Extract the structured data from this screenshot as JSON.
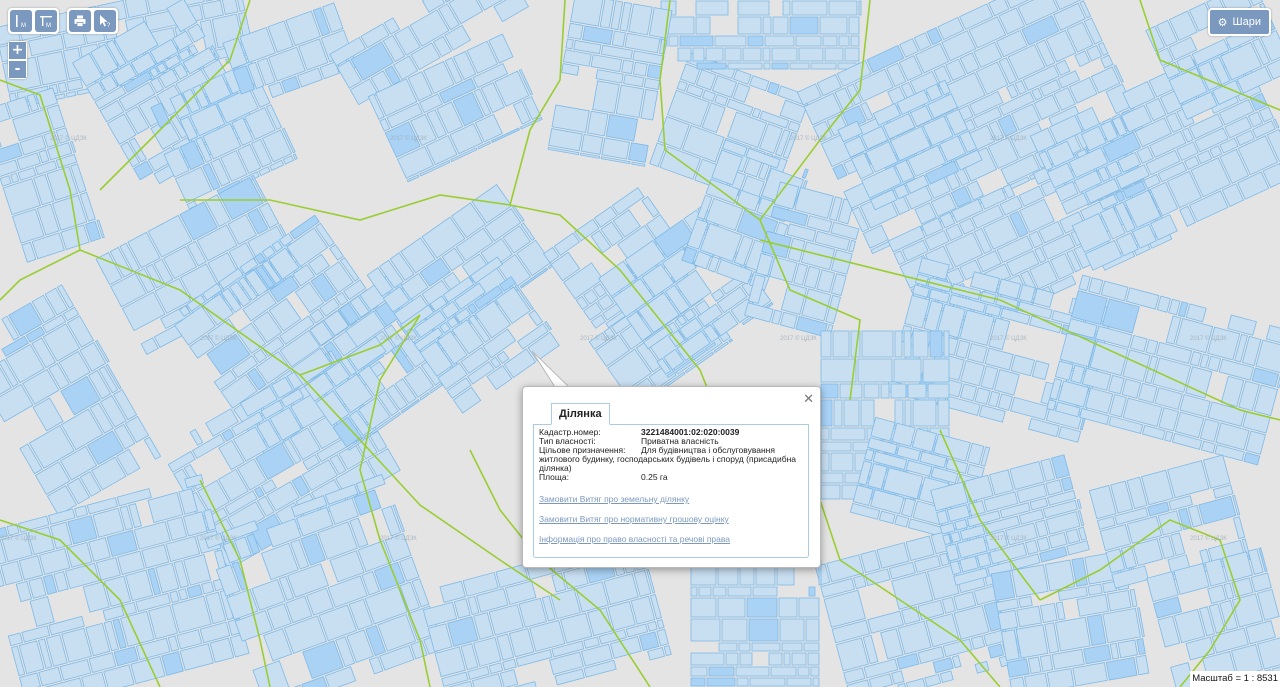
{
  "toolbar": {
    "measure_distance_label": "M",
    "measure_area_label": "M",
    "print_icon": "print-icon",
    "identify_icon": "cursor-question-icon"
  },
  "zoom": {
    "in_label": "+",
    "out_label": "-"
  },
  "layers": {
    "label": "Шари",
    "icon": "gear-icon"
  },
  "watermark": "2017 © ЦДЗК",
  "popup": {
    "tab_label": "Ділянка",
    "fields": {
      "cadastral_label": "Кадастр.номер:",
      "cadastral_value": "3221484001:02:020:0039",
      "ownership_label": "Тип власності:",
      "ownership_value": "Приватна власність",
      "purpose_label": "Цільове призначення:",
      "purpose_value": "Для будівництва і обслуговування",
      "purpose_continuation": "житлового будинку, господарських будівель і споруд (присадибна ділянка)",
      "area_label": "Площа:",
      "area_value": "0.25 га"
    },
    "links": [
      "Замовити Витяг про земельну ділянку",
      "Замовити Витяг про нормативну грошову оцінку",
      "Інформація про право власності та речові права"
    ]
  },
  "scale": {
    "label": "Масштаб = 1 : 8531"
  },
  "colors": {
    "background": "#e4e4e4",
    "parcel_fill": "#c8dff1",
    "parcel_stroke": "#7fb9e6",
    "parcel_highlight": "#a9d2f5",
    "boundary_green": "#9acd32",
    "ui_button": "#7b98bf",
    "link": "#7b98bf"
  }
}
